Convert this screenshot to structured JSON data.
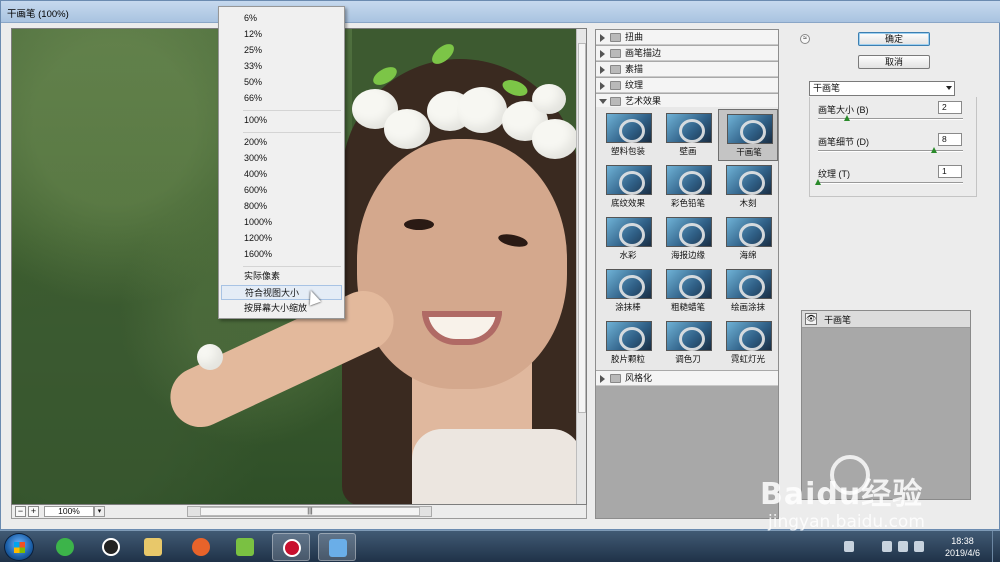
{
  "window": {
    "title": "干画笔 (100%)"
  },
  "zoom_bar": {
    "minus": "−",
    "plus": "+",
    "value": "100%",
    "dropdown": "▾",
    "scroll_grip": "|||"
  },
  "zoom_menu": {
    "items": [
      "6%",
      "12%",
      "25%",
      "33%",
      "50%",
      "66%",
      "100%",
      "200%",
      "300%",
      "400%",
      "600%",
      "800%",
      "1000%",
      "1200%",
      "1600%",
      "实际像素",
      "符合视图大小",
      "按屏幕大小缩放"
    ],
    "selected": "符合视图大小"
  },
  "gallery": {
    "categories_top": [
      "扭曲",
      "画笔描边",
      "素描",
      "纹理"
    ],
    "open_category": "艺术效果",
    "filters": [
      "塑料包装",
      "壁画",
      "干画笔",
      "底纹效果",
      "彩色铅笔",
      "木刻",
      "水彩",
      "海报边缘",
      "海绵",
      "涂抹棒",
      "粗糙蜡笔",
      "绘画涂抹",
      "胶片颗粒",
      "调色刀",
      "霓虹灯光"
    ],
    "selected_filter": "干画笔",
    "categories_bottom": [
      "风格化"
    ]
  },
  "panel": {
    "collapse_icon": "≈",
    "ok_label": "确定",
    "cancel_label": "取消",
    "filter_select": "干画笔",
    "params": [
      {
        "label": "画笔大小 (B)",
        "value": "2",
        "level": 0.2
      },
      {
        "label": "画笔细节 (D)",
        "value": "8",
        "level": 0.8
      },
      {
        "label": "纹理 (T)",
        "value": "1",
        "level": 0.0
      }
    ],
    "layer_name": "干画笔",
    "layer_eye": "👁"
  },
  "taskbar": {
    "time": "18:38",
    "date": "2019/4/6"
  },
  "watermark": {
    "brand": "Baidu经验",
    "url": "jingyan.baidu.com"
  },
  "colors": {
    "accent": "#3c7fb1",
    "taskbar": "#1f3248",
    "gallery_bg": "#a8a8a8"
  }
}
